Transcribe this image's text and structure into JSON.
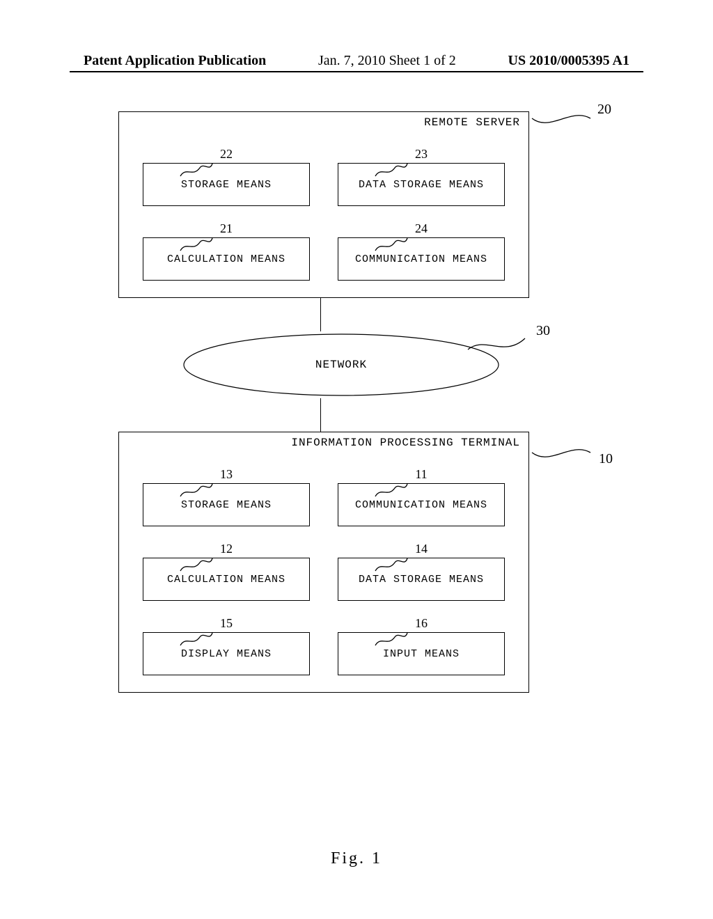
{
  "header": {
    "left": "Patent Application Publication",
    "center": "Jan. 7, 2010  Sheet 1 of 2",
    "right": "US 2010/0005395 A1"
  },
  "remote_server": {
    "title": "REMOTE SERVER",
    "ref": "20",
    "boxes": {
      "b22": {
        "num": "22",
        "label": "STORAGE MEANS"
      },
      "b23": {
        "num": "23",
        "label": "DATA STORAGE MEANS"
      },
      "b21": {
        "num": "21",
        "label": "CALCULATION MEANS"
      },
      "b24": {
        "num": "24",
        "label": "COMMUNICATION MEANS"
      }
    }
  },
  "network": {
    "label": "NETWORK",
    "ref": "30"
  },
  "terminal": {
    "title": "INFORMATION PROCESSING TERMINAL",
    "ref": "10",
    "boxes": {
      "b13": {
        "num": "13",
        "label": "STORAGE MEANS"
      },
      "b11": {
        "num": "11",
        "label": "COMMUNICATION MEANS"
      },
      "b12": {
        "num": "12",
        "label": "CALCULATION MEANS"
      },
      "b14": {
        "num": "14",
        "label": "DATA STORAGE MEANS"
      },
      "b15": {
        "num": "15",
        "label": "DISPLAY MEANS"
      },
      "b16": {
        "num": "16",
        "label": "INPUT MEANS"
      }
    }
  },
  "figure_caption": "Fig. 1"
}
